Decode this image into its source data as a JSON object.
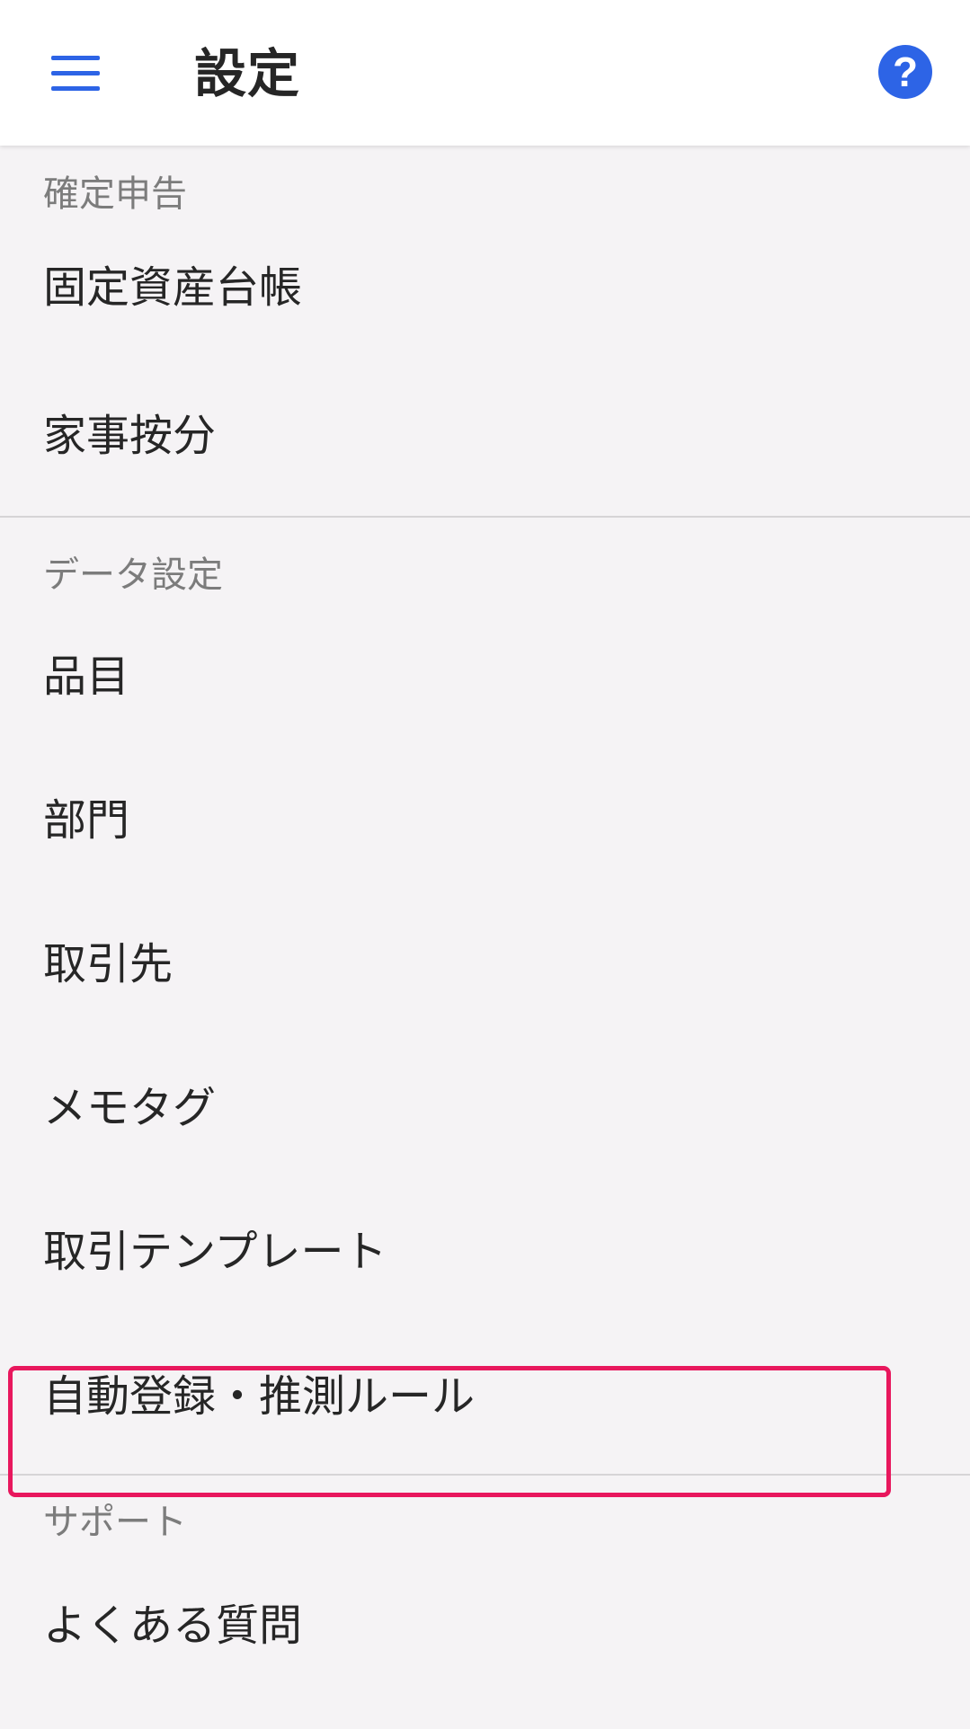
{
  "header": {
    "title": "設定",
    "menu_icon": "hamburger-menu-icon",
    "help_icon": "help-circle-icon",
    "help_glyph": "?",
    "accent_color": "#2d64e6"
  },
  "sections": [
    {
      "title": "確定申告",
      "items": [
        "固定資産台帳",
        "家事按分"
      ]
    },
    {
      "title": "データ設定",
      "items": [
        "品目",
        "部門",
        "取引先",
        "メモタグ",
        "取引テンプレート",
        "自動登録・推測ルール"
      ]
    },
    {
      "title": "サポート",
      "items": [
        "よくある質問"
      ]
    }
  ],
  "highlight": {
    "item": "自動登録・推測ルール",
    "color": "#e8175d"
  }
}
